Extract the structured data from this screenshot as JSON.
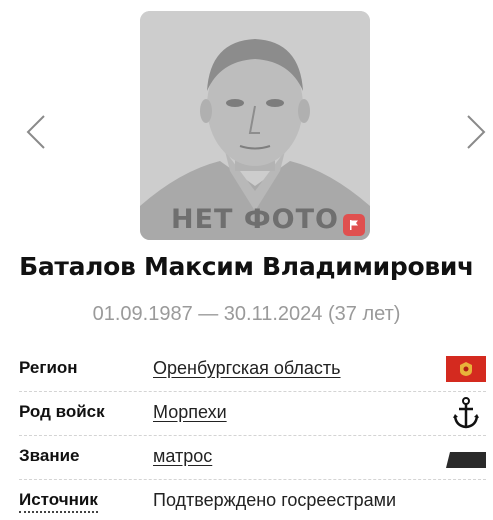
{
  "photo": {
    "placeholder_text": "НЕТ ФОТО",
    "flag_icon": "flag-icon",
    "flag_color": "#e0504f"
  },
  "navigation": {
    "prev_icon": "chevron-left-icon",
    "next_icon": "chevron-right-icon"
  },
  "person": {
    "full_name": "Баталов Максим Владимирович",
    "dates": "01.09.1987 — 30.11.2024 (37 лет)"
  },
  "details": [
    {
      "label": "Регион",
      "value": "Оренбургская область",
      "icon": "region-flag-icon",
      "icon_color": "#d42a1f"
    },
    {
      "label": "Род войск",
      "value": "Морпехи",
      "icon": "anchor-icon",
      "icon_color": "#111111"
    },
    {
      "label": "Звание",
      "value": "матрос",
      "icon": "rank-insignia-icon",
      "icon_color": "#2a2a2a"
    },
    {
      "label": "Источник",
      "value": "Подтверждено госреестрами"
    }
  ]
}
